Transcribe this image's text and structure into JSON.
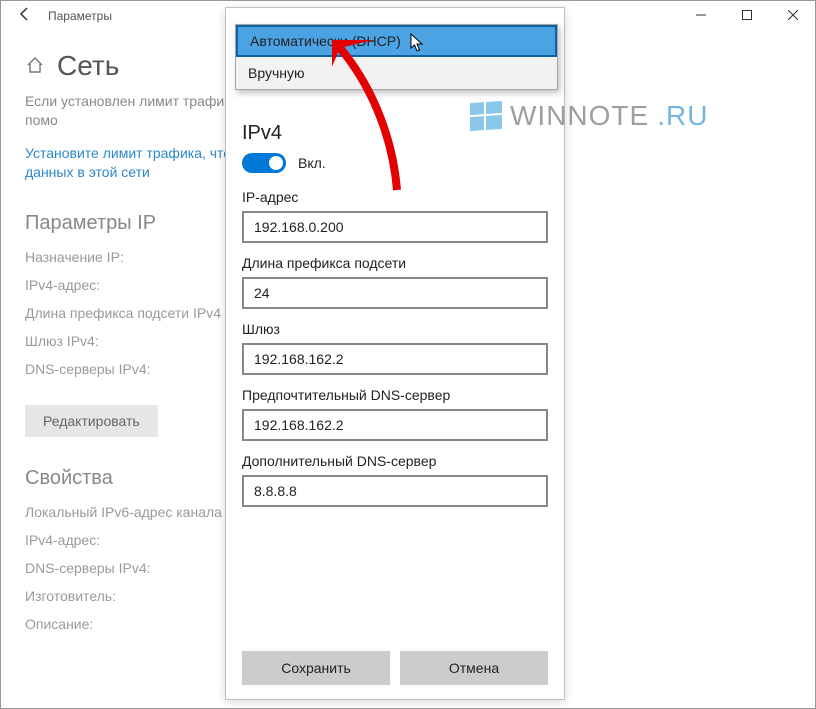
{
  "window": {
    "title": "Параметры"
  },
  "bg": {
    "heading": "Сеть",
    "desc": "Если установлен лимит трафика, подключение, которое помо",
    "link": "Установите лимит трафика, чтобы данных в этой сети",
    "section_ip": "Параметры IP",
    "labels": {
      "assign": "Назначение IP:",
      "ipv4addr": "IPv4-адрес:",
      "prefix": "Длина префикса подсети IPv4",
      "gateway": "Шлюз IPv4:",
      "dns": "DNS-серверы IPv4:"
    },
    "edit": "Редактировать",
    "section_props": "Свойства",
    "labels2": {
      "localv6": "Локальный IPv6-адрес канала",
      "ipv4": "IPv4-адрес:",
      "dns2": "DNS-серверы IPv4:",
      "vendor": "Изготовитель:",
      "desc2": "Описание:"
    }
  },
  "dropdown": {
    "opt_auto": "Автоматически (DHCP)",
    "opt_manual": "Вручную"
  },
  "dialog": {
    "ipv4_heading": "IPv4",
    "toggle_label": "Вкл.",
    "labels": {
      "ip": "IP-адрес",
      "prefix": "Длина префикса подсети",
      "gateway": "Шлюз",
      "dns1": "Предпочтительный DNS-сервер",
      "dns2": "Дополнительный DNS-сервер"
    },
    "values": {
      "ip": "192.168.0.200",
      "prefix": "24",
      "gateway": "192.168.162.2",
      "dns1": "192.168.162.2",
      "dns2": "8.8.8.8"
    },
    "save": "Сохранить",
    "cancel": "Отмена"
  },
  "watermark": {
    "text1": "WINNOTE",
    "text2": ".RU"
  }
}
